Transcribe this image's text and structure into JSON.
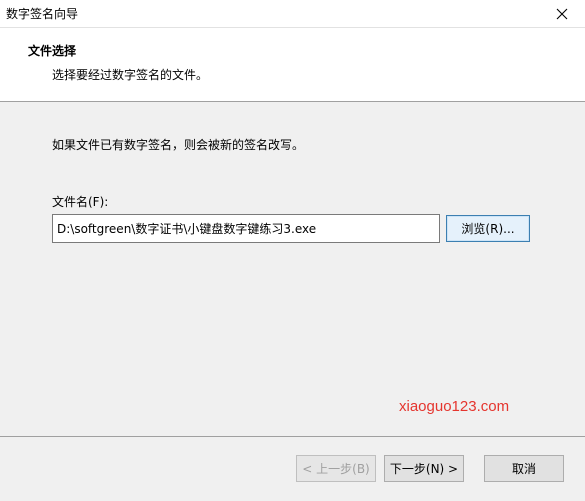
{
  "window": {
    "title": "数字签名向导"
  },
  "header": {
    "title": "文件选择",
    "subtitle": "选择要经过数字签名的文件。"
  },
  "main": {
    "info_text": "如果文件已有数字签名，则会被新的签名改写。",
    "filename_label": "文件名(F):",
    "filename_value": "D:\\softgreen\\数字证书\\小键盘数字键练习3.exe",
    "browse_label": "浏览(R)...",
    "watermark": "xiaoguo123.com"
  },
  "footer": {
    "back_label": "< 上一步(B)",
    "next_label": "下一步(N) >",
    "cancel_label": "取消"
  },
  "icons": {
    "close": "close-icon"
  }
}
